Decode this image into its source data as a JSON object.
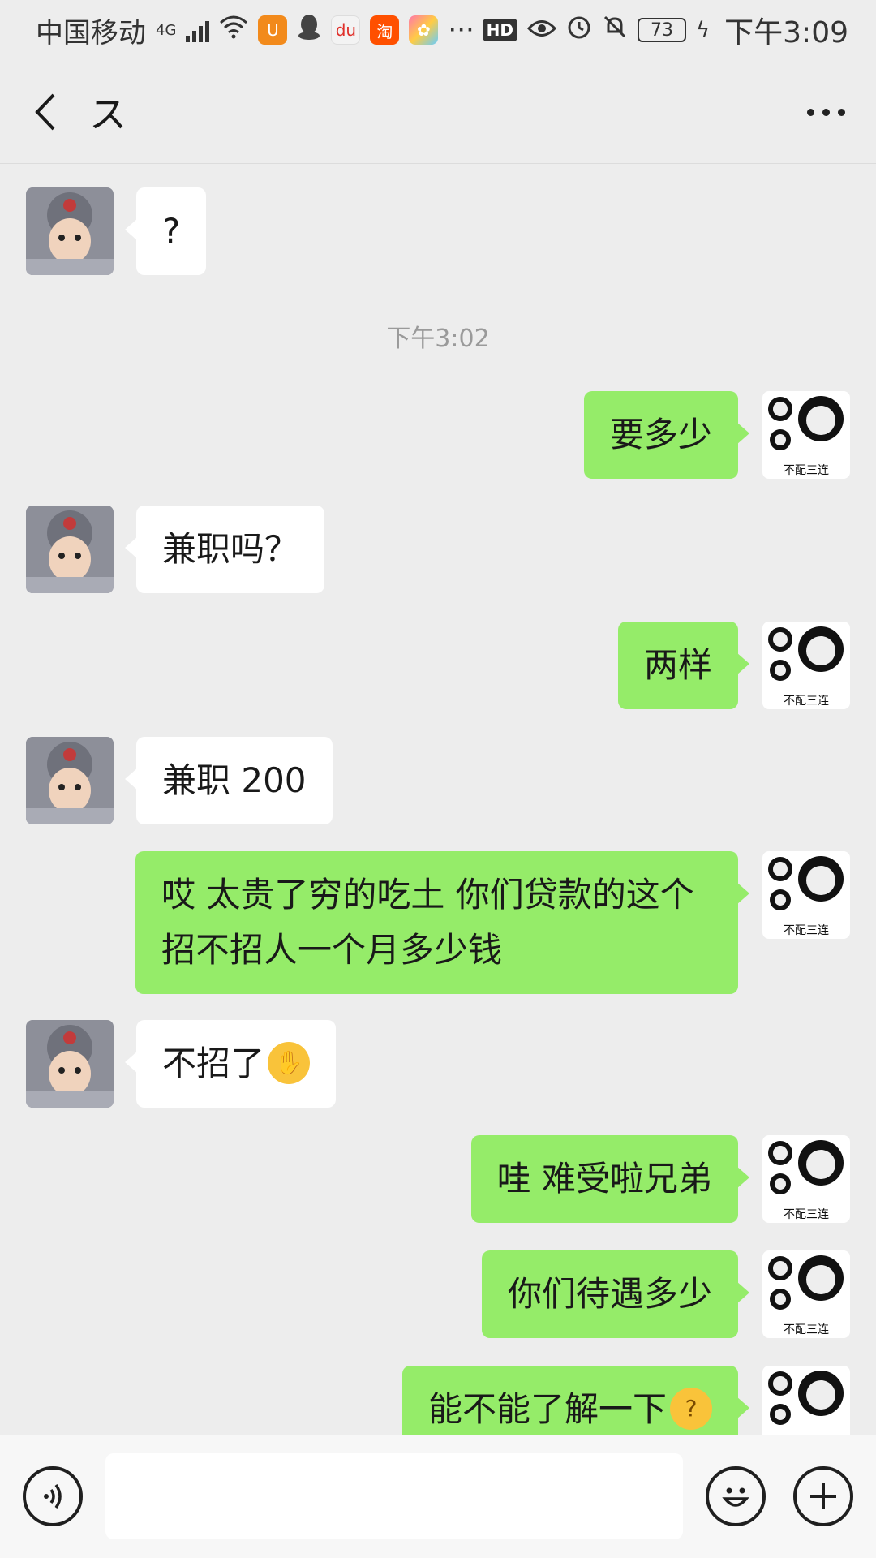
{
  "status_bar": {
    "carrier": "中国移动",
    "network": "4G",
    "more": "···",
    "hd": "HD",
    "battery": "73",
    "time": "下午3:09",
    "app_icons": [
      "uc-browser-icon",
      "qq-icon",
      "baidu-maps-icon",
      "taobao-icon",
      "photos-icon"
    ]
  },
  "nav": {
    "title": "ス"
  },
  "chat": {
    "messages": [
      {
        "side": "in",
        "text": "?"
      },
      {
        "side": "time",
        "text": "下午3:02"
      },
      {
        "side": "out",
        "text": "要多少"
      },
      {
        "side": "in",
        "text": "兼职吗？"
      },
      {
        "side": "out",
        "text": "两样"
      },
      {
        "side": "in",
        "text": "兼职 200"
      },
      {
        "side": "out",
        "text": "哎  太贵了穷的吃土  你们贷款的这个招不招人一个月多少钱"
      },
      {
        "side": "in",
        "text": "不招了",
        "emoji": "facepalm-emoji"
      },
      {
        "side": "out",
        "text": "哇  难受啦兄弟"
      },
      {
        "side": "out",
        "text": "你们待遇多少"
      },
      {
        "side": "out",
        "text": "能不能了解一下",
        "emoji": "thinking-emoji"
      }
    ],
    "sticker_caption": "不配三连"
  },
  "input_bar": {
    "placeholder": ""
  },
  "colors": {
    "outgoing_bubble": "#95ec69",
    "incoming_bubble": "#ffffff",
    "background": "#ededed"
  }
}
